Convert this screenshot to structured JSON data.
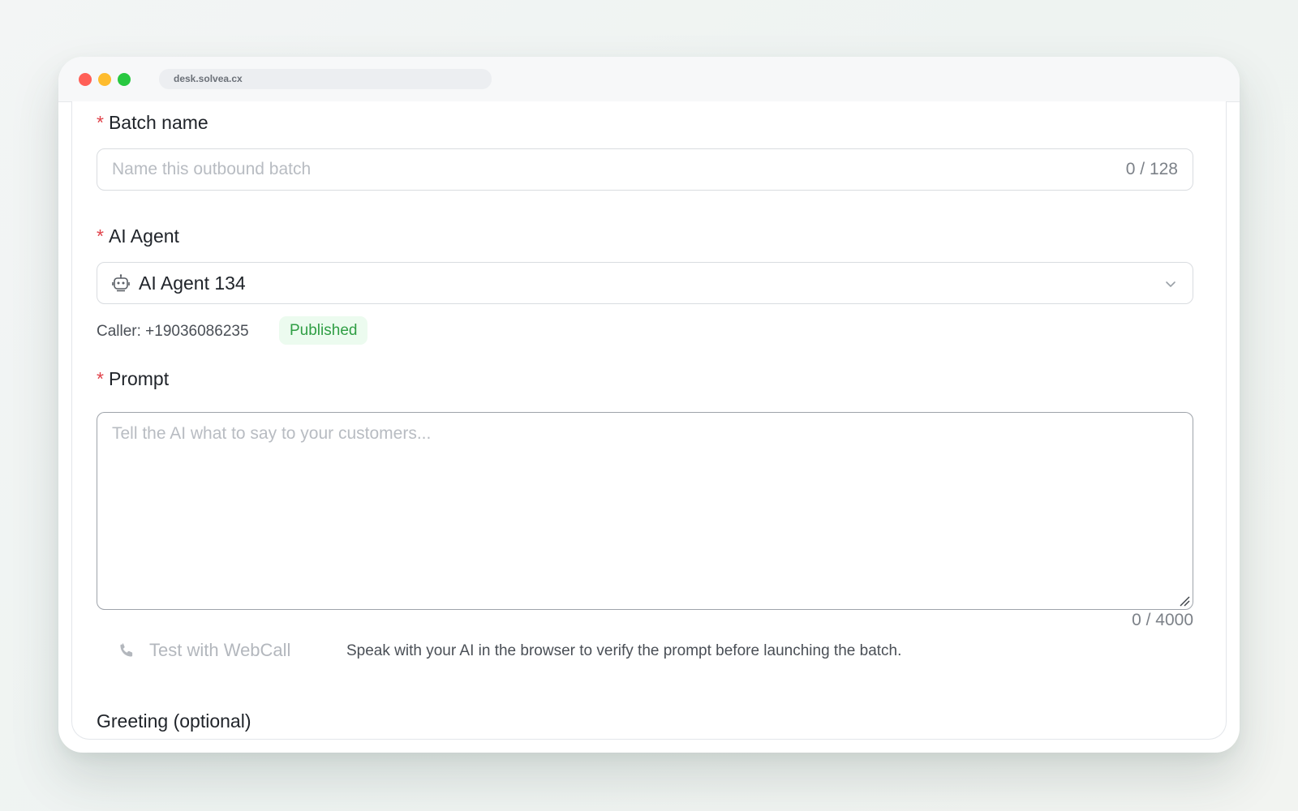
{
  "browser": {
    "url": "desk.solvea.cx"
  },
  "form": {
    "batch_name": {
      "required_mark": "*",
      "label": "Batch name",
      "placeholder": "Name this outbound batch",
      "counter": "0 / 128"
    },
    "ai_agent": {
      "required_mark": "*",
      "label": "AI Agent",
      "selected": "AI Agent 134",
      "icon": "robot-icon",
      "caller": "Caller: +19036086235",
      "status_badge": "Published"
    },
    "prompt": {
      "required_mark": "*",
      "label": "Prompt",
      "placeholder": "Tell the AI what to say to your customers...",
      "counter": "0 / 4000"
    },
    "webcall": {
      "icon": "phone-icon",
      "label": "Test with WebCall",
      "help_text": "Speak with your AI in the browser to verify the prompt before launching the batch."
    },
    "greeting": {
      "label": "Greeting (optional)"
    }
  },
  "colors": {
    "required": "#e0424a",
    "badge_bg": "#ecfbef",
    "badge_text": "#2f9e44",
    "disabled_text": "#b3b7bd"
  }
}
